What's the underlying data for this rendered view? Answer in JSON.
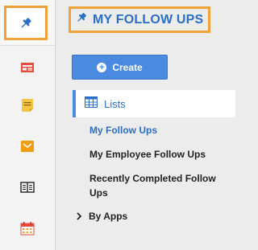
{
  "header": {
    "title": "MY FOLLOW UPS"
  },
  "toolbar": {
    "create_label": "Create"
  },
  "lists": {
    "header_label": "Lists",
    "items": [
      {
        "label": "My Follow Ups",
        "active": true
      },
      {
        "label": "My Employee Follow Ups",
        "active": false
      },
      {
        "label": "Recently Completed Follow Ups",
        "active": false
      }
    ]
  },
  "by_apps": {
    "label": "By Apps"
  },
  "sidebar": {
    "items": [
      {
        "icon": "pin-icon",
        "active": true
      },
      {
        "icon": "presentation-icon",
        "active": false
      },
      {
        "icon": "note-icon",
        "active": false
      },
      {
        "icon": "mail-icon",
        "active": false
      },
      {
        "icon": "book-icon",
        "active": false
      },
      {
        "icon": "calendar-icon",
        "active": false
      }
    ]
  },
  "colors": {
    "accent_blue": "#2a6fc7",
    "button_blue": "#4a8ae0",
    "highlight_orange": "#f0a23a",
    "icon_red": "#e74c3c",
    "icon_yellow": "#f5c542",
    "icon_orange": "#f39c12"
  }
}
